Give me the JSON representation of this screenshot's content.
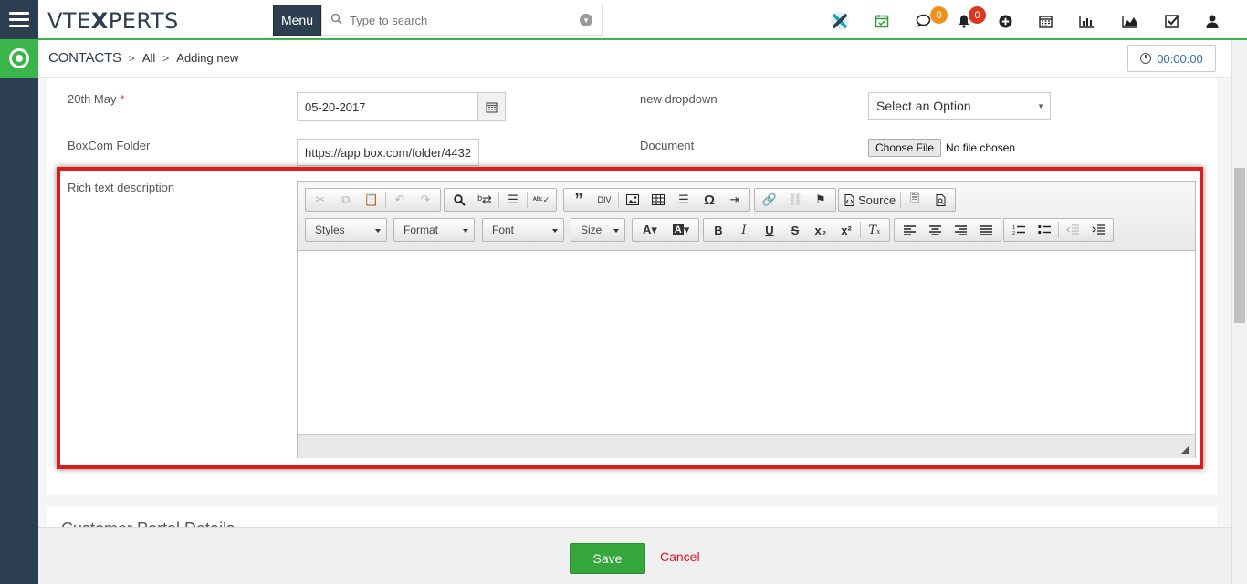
{
  "topbar": {
    "logo_part1": "VTE",
    "logo_x": "X",
    "logo_part2": "PERTS",
    "menu_label": "Menu",
    "search_placeholder": "Type to search",
    "chat_badge": "0",
    "notif_badge": "0",
    "colors": {
      "accent": "#39b54a",
      "nav": "#2d3e50",
      "badge_orange": "#f0901c",
      "badge_red": "#d9381e"
    }
  },
  "breadcrumb": {
    "module": "CONTACTS",
    "sep": ">",
    "list": "All",
    "current": "Adding new"
  },
  "timer": {
    "value": "00:00:00"
  },
  "form": {
    "date_label": "20th May",
    "required_mark": "*",
    "date_value": "05-20-2017",
    "dropdown_label": "new dropdown",
    "dropdown_value": "Select an Option",
    "boxcom_label": "BoxCom Folder",
    "boxcom_value": "https://app.box.com/folder/4432",
    "document_label": "Document",
    "choose_file": "Choose File",
    "no_file": "No file chosen",
    "rich_label": "Rich text description"
  },
  "editor": {
    "styles": "Styles",
    "format": "Format",
    "font": "Font",
    "size": "Size",
    "source": "Source"
  },
  "section2": {
    "title": "Customer Portal Details"
  },
  "footer": {
    "save": "Save",
    "cancel": "Cancel"
  }
}
